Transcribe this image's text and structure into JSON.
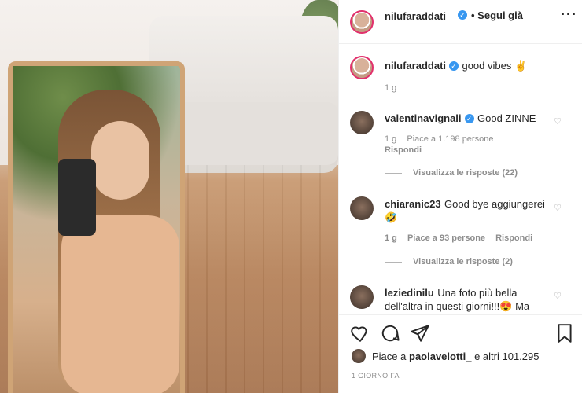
{
  "post": {
    "author": "nilufaraddati",
    "follow_status": "• Segui già",
    "more_icon": "more-horizontal-icon",
    "caption_text": "good vibes ✌",
    "caption_time": "1 g"
  },
  "comments": [
    {
      "username": "valentinavignali",
      "text": "Good ZINNE",
      "time": "1 g",
      "likes": "Piace a 1.198 persone",
      "reply": "Rispondi",
      "view_replies": "Visualizza le risposte (22)"
    },
    {
      "username": "chiaranic23",
      "text": "Good bye aggiungerei 🤣",
      "time": "1 g",
      "likes": "Piace a 93 persone",
      "reply": "Rispondi",
      "view_replies": "Visualizza le risposte (2)"
    },
    {
      "username": "leziedinilu",
      "text": "Una foto più bella dell'altra in questi giorni!!!😍 Ma"
    }
  ],
  "likes_line": {
    "prefix": "Piace a",
    "user": "paolavelotti_",
    "suffix": "e altri 101.295"
  },
  "timestamp": "1 GIORNO FA",
  "icons": [
    "heart-icon",
    "comment-icon",
    "share-icon",
    "bookmark-icon"
  ],
  "colors": {
    "accent": "#3897f0",
    "story_ring": "#e1306c",
    "text": "#262626",
    "muted": "#8e8e8e"
  }
}
